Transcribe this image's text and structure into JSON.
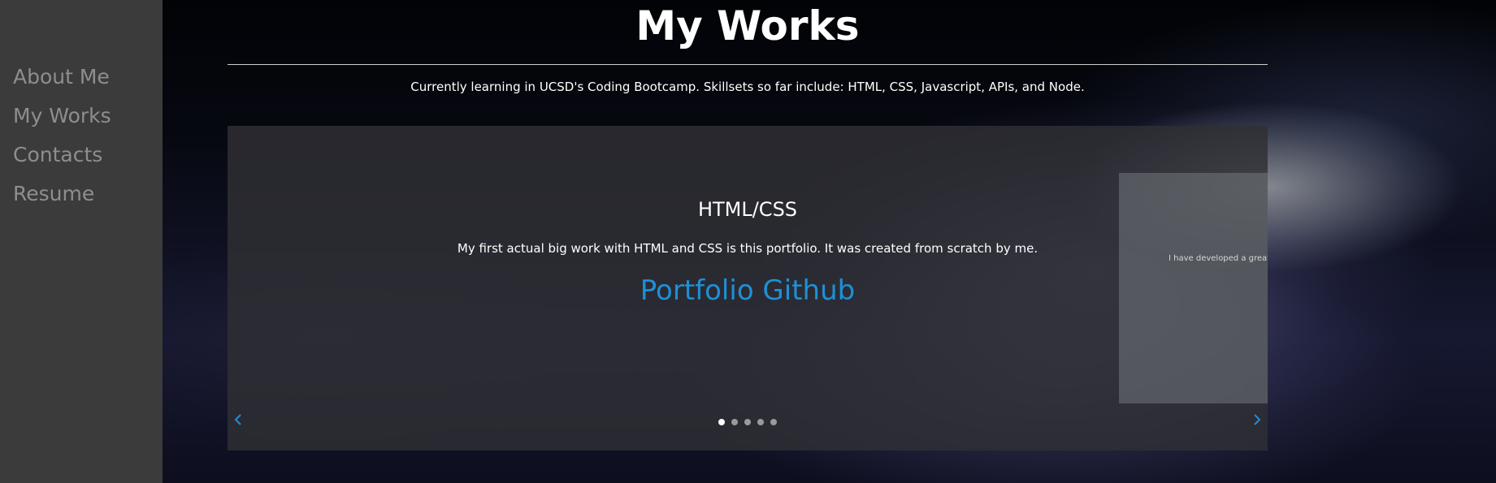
{
  "sidebar": {
    "items": [
      {
        "label": "About Me"
      },
      {
        "label": "My Works"
      },
      {
        "label": "Contacts"
      },
      {
        "label": "Resume"
      }
    ]
  },
  "main": {
    "title": "My Works",
    "subtitle": "Currently learning in UCSD's Coding Bootcamp. Skillsets so far include: HTML, CSS, Javascript, APIs, and Node."
  },
  "carousel": {
    "current_slide": {
      "title": "HTML/CSS",
      "text": "My first actual big work with HTML and CSS is this portfolio. It was created from scratch by me.",
      "link_label": "Portfolio Github"
    },
    "next_slide_preview_text": "I have developed a great",
    "active_index": 1,
    "slide_count": 5,
    "prev_icon": "chevron-left-icon",
    "next_icon": "chevron-right-icon"
  },
  "colors": {
    "sidebar_bg": "#3b3b3b",
    "nav_text": "#8e8e8e",
    "link_accent": "#1e90d6",
    "carousel_bg": "#303034"
  }
}
